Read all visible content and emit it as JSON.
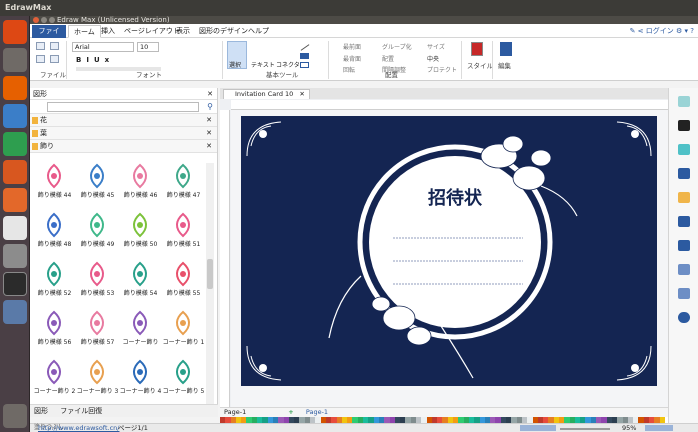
{
  "os_bar": {
    "title": "EdrawMax"
  },
  "window": {
    "title": "Edraw Max (Unlicensed Version)"
  },
  "menu": {
    "file": "ファイル",
    "tabs": [
      "ホーム",
      "挿入",
      "ページレイアウト",
      "表示",
      "図形のデザイン",
      "ヘルプ"
    ],
    "login": "ログイン"
  },
  "ribbon": {
    "font_name": "Arial",
    "font_size": "10",
    "groups": {
      "file": "ファイル",
      "font": "フォント",
      "basic_tools": "基本ツール",
      "arrange": "配置",
      "style": "スタイル",
      "edit": "編集"
    },
    "tools": {
      "select": "選択",
      "text": "テキスト",
      "connector": "コネクタ"
    },
    "arrange_items": [
      "最前面",
      "グループ化",
      "サイズ",
      "最背面",
      "配置",
      "中央",
      "回転",
      "間隔調整",
      "プロテクト"
    ]
  },
  "library": {
    "header": "図形",
    "categories": [
      "花",
      "葉",
      "飾り"
    ],
    "shapes": [
      {
        "label": "飾り模様 44",
        "color": "#e85a8a"
      },
      {
        "label": "飾り模様 45",
        "color": "#3a7ec8"
      },
      {
        "label": "飾り模様 46",
        "color": "#e87aa0"
      },
      {
        "label": "飾り模様 47",
        "color": "#3fa88a"
      },
      {
        "label": "飾り模様 48",
        "color": "#3a6ec8"
      },
      {
        "label": "飾り模様 49",
        "color": "#3fb88a"
      },
      {
        "label": "飾り模様 50",
        "color": "#7cc23a"
      },
      {
        "label": "飾り模様 51",
        "color": "#e85a8a"
      },
      {
        "label": "飾り模様 52",
        "color": "#28a08a"
      },
      {
        "label": "飾り模様 53",
        "color": "#e85a8a"
      },
      {
        "label": "飾り模様 54",
        "color": "#28a08a"
      },
      {
        "label": "飾り模様 55",
        "color": "#e8506a"
      },
      {
        "label": "飾り模様 56",
        "color": "#8a5ab8"
      },
      {
        "label": "飾り模様 57",
        "color": "#e87aa0"
      },
      {
        "label": "コーナー飾り",
        "color": "#8a5ab8"
      },
      {
        "label": "コーナー飾り 1",
        "color": "#e8a050"
      },
      {
        "label": "コーナー飾り 2",
        "color": "#8a5ab8"
      },
      {
        "label": "コーナー飾り 3",
        "color": "#e8a050"
      },
      {
        "label": "コーナー飾り 4",
        "color": "#2a6ab8"
      },
      {
        "label": "コーナー飾り 5",
        "color": "#28a08a"
      }
    ],
    "bottom_tabs": [
      "図形",
      "ファイル回復"
    ]
  },
  "document": {
    "tab": "Invitation Card 10",
    "card_title": "招待状",
    "colors": {
      "card": "#142552",
      "ornament": "#ffffff"
    }
  },
  "pages": {
    "current": "Page-1",
    "active": "Page-1"
  },
  "status": {
    "url": "http://www.edrawsoft.cn/",
    "page": "ページ1/1",
    "zoom": "95%"
  },
  "bottom_label": "塗りつぶし"
}
